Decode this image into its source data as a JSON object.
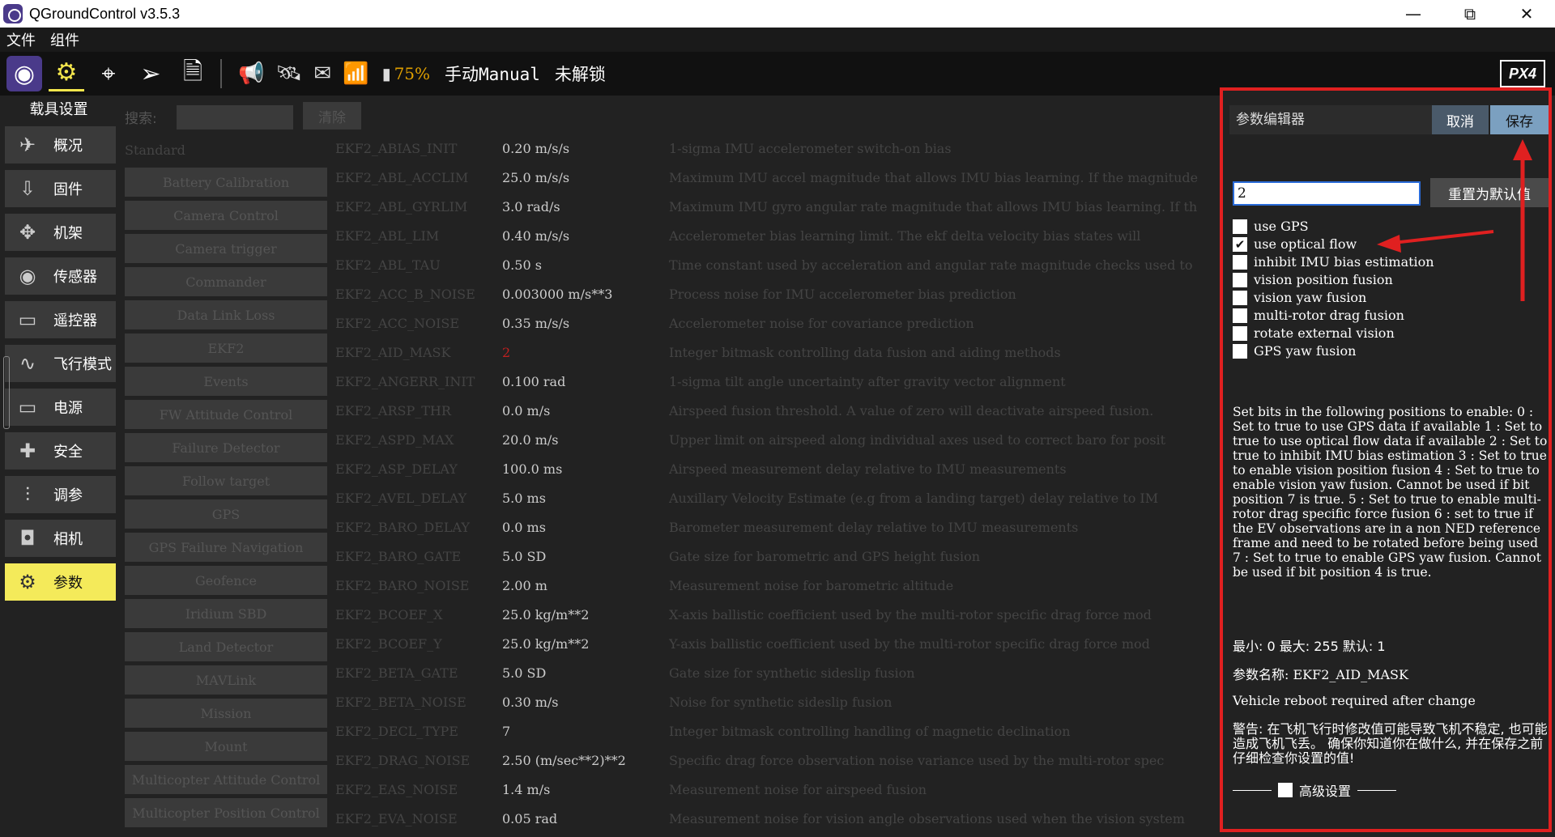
{
  "window": {
    "title": "QGroundControl v3.5.3",
    "min": "—",
    "max": "⧉",
    "close": "✕"
  },
  "menu": {
    "file": "文件",
    "widgets": "组件"
  },
  "toolbar": {
    "battery_pct": "75%",
    "flight_mode": "手动Manual",
    "arm_state": "未解锁",
    "brand": "PX4"
  },
  "sidebar": {
    "title": "载具设置",
    "items": [
      {
        "label": "概况",
        "icon": "✈"
      },
      {
        "label": "固件",
        "icon": "⇩"
      },
      {
        "label": "机架",
        "icon": "✥"
      },
      {
        "label": "传感器",
        "icon": "◉"
      },
      {
        "label": "遥控器",
        "icon": "▭"
      },
      {
        "label": "飞行模式",
        "icon": "∿"
      },
      {
        "label": "电源",
        "icon": "▭"
      },
      {
        "label": "安全",
        "icon": "✚"
      },
      {
        "label": "调参",
        "icon": "⫶"
      },
      {
        "label": "相机",
        "icon": "◘"
      },
      {
        "label": "参数",
        "icon": "⚙"
      }
    ]
  },
  "search": {
    "label": "搜索:",
    "value": "",
    "clear": "清除"
  },
  "group_header": "Standard",
  "groups": [
    "Battery Calibration",
    "Camera Control",
    "Camera trigger",
    "Commander",
    "Data Link Loss",
    "EKF2",
    "Events",
    "FW Attitude Control",
    "Failure Detector",
    "Follow target",
    "GPS",
    "GPS Failure Navigation",
    "Geofence",
    "Iridium SBD",
    "Land Detector",
    "MAVLink",
    "Mission",
    "Mount",
    "Multicopter Attitude Control",
    "Multicopter Position Control"
  ],
  "params": [
    {
      "name": "EKF2_ABIAS_INIT",
      "value": "0.20 m/s/s",
      "desc": "1-sigma IMU accelerometer switch-on bias"
    },
    {
      "name": "EKF2_ABL_ACCLIM",
      "value": "25.0 m/s/s",
      "desc": "Maximum IMU accel magnitude that allows IMU bias learning. If the magnitude"
    },
    {
      "name": "EKF2_ABL_GYRLIM",
      "value": "3.0 rad/s",
      "desc": "Maximum IMU gyro angular rate magnitude that allows IMU bias learning. If th"
    },
    {
      "name": "EKF2_ABL_LIM",
      "value": "0.40 m/s/s",
      "desc": "Accelerometer bias learning limit. The ekf delta velocity bias states will"
    },
    {
      "name": "EKF2_ABL_TAU",
      "value": "0.50 s",
      "desc": "Time constant used by acceleration and angular rate magnitude checks used to"
    },
    {
      "name": "EKF2_ACC_B_NOISE",
      "value": "0.003000 m/s**3",
      "desc": "Process noise for IMU accelerometer bias prediction"
    },
    {
      "name": "EKF2_ACC_NOISE",
      "value": "0.35 m/s/s",
      "desc": "Accelerometer noise for covariance prediction"
    },
    {
      "name": "EKF2_AID_MASK",
      "value": "2",
      "desc": "Integer bitmask controlling data fusion and aiding methods",
      "highlight": true
    },
    {
      "name": "EKF2_ANGERR_INIT",
      "value": "0.100 rad",
      "desc": "1-sigma tilt angle uncertainty after gravity vector alignment"
    },
    {
      "name": "EKF2_ARSP_THR",
      "value": "0.0 m/s",
      "desc": "Airspeed fusion threshold. A value of zero will deactivate airspeed fusion."
    },
    {
      "name": "EKF2_ASPD_MAX",
      "value": "20.0 m/s",
      "desc": "Upper limit on airspeed along individual axes used to correct baro for posit"
    },
    {
      "name": "EKF2_ASP_DELAY",
      "value": "100.0 ms",
      "desc": "Airspeed measurement delay relative to IMU measurements"
    },
    {
      "name": "EKF2_AVEL_DELAY",
      "value": "5.0 ms",
      "desc": "Auxillary Velocity Estimate (e.g from a landing target) delay relative to IM"
    },
    {
      "name": "EKF2_BARO_DELAY",
      "value": "0.0 ms",
      "desc": "Barometer measurement delay relative to IMU measurements"
    },
    {
      "name": "EKF2_BARO_GATE",
      "value": "5.0 SD",
      "desc": "Gate size for barometric and GPS height fusion"
    },
    {
      "name": "EKF2_BARO_NOISE",
      "value": "2.00 m",
      "desc": "Measurement noise for barometric altitude"
    },
    {
      "name": "EKF2_BCOEF_X",
      "value": "25.0 kg/m**2",
      "desc": "X-axis ballistic coefficient used by the multi-rotor specific drag force mod"
    },
    {
      "name": "EKF2_BCOEF_Y",
      "value": "25.0 kg/m**2",
      "desc": "Y-axis ballistic coefficient used by the multi-rotor specific drag force mod"
    },
    {
      "name": "EKF2_BETA_GATE",
      "value": "5.0 SD",
      "desc": "Gate size for synthetic sideslip fusion"
    },
    {
      "name": "EKF2_BETA_NOISE",
      "value": "0.30 m/s",
      "desc": "Noise for synthetic sideslip fusion"
    },
    {
      "name": "EKF2_DECL_TYPE",
      "value": "7",
      "desc": "Integer bitmask controlling handling of magnetic declination"
    },
    {
      "name": "EKF2_DRAG_NOISE",
      "value": "2.50 (m/sec**2)**2",
      "desc": "Specific drag force observation noise variance used by the multi-rotor spec"
    },
    {
      "name": "EKF2_EAS_NOISE",
      "value": "1.4 m/s",
      "desc": "Measurement noise for airspeed fusion"
    },
    {
      "name": "EKF2_EVA_NOISE",
      "value": "0.05 rad",
      "desc": "Measurement noise for vision angle observations used when the vision system"
    }
  ],
  "editor": {
    "title": "参数编辑器",
    "cancel": "取消",
    "save": "保存",
    "value": "2",
    "reset": "重置为默认值",
    "checkboxes": [
      {
        "label": "use GPS",
        "checked": false
      },
      {
        "label": "use optical flow",
        "checked": true
      },
      {
        "label": "inhibit IMU bias estimation",
        "checked": false
      },
      {
        "label": "vision position fusion",
        "checked": false
      },
      {
        "label": "vision yaw fusion",
        "checked": false
      },
      {
        "label": "multi-rotor drag fusion",
        "checked": false
      },
      {
        "label": "rotate external vision",
        "checked": false
      },
      {
        "label": "GPS yaw fusion",
        "checked": false
      }
    ],
    "description": "Set bits in the following positions to enable: 0 : Set to true to use GPS data if available 1 : Set to true to use optical flow data if available 2 : Set to true to inhibit IMU bias estimation 3 : Set to true to enable vision position fusion 4 : Set to true to enable vision yaw fusion. Cannot be used if bit position 7 is true. 5 : Set to true to enable multi-rotor drag specific force fusion 6 : set to true if the EV observations are in a non NED reference frame and need to be rotated before being used 7 : Set to true to enable GPS yaw fusion. Cannot be used if bit position 4 is true.",
    "range": "最小:  0 最大:  255 默认:  1",
    "param_name": "参数名称:  EKF2_AID_MASK",
    "reboot": "Vehicle reboot required after change",
    "warning": "警告: 在飞机飞行时修改值可能导致飞机不稳定, 也可能造成飞机飞丢。 确保你知道你在做什么, 并在保存之前仔细检查你设置的值!",
    "advanced": "高级设置"
  },
  "colors": {
    "accent": "#f4ea5a",
    "annotation": "#e02020",
    "save_button": "#7ba0c0",
    "cancel_button": "#4a5a6a"
  }
}
